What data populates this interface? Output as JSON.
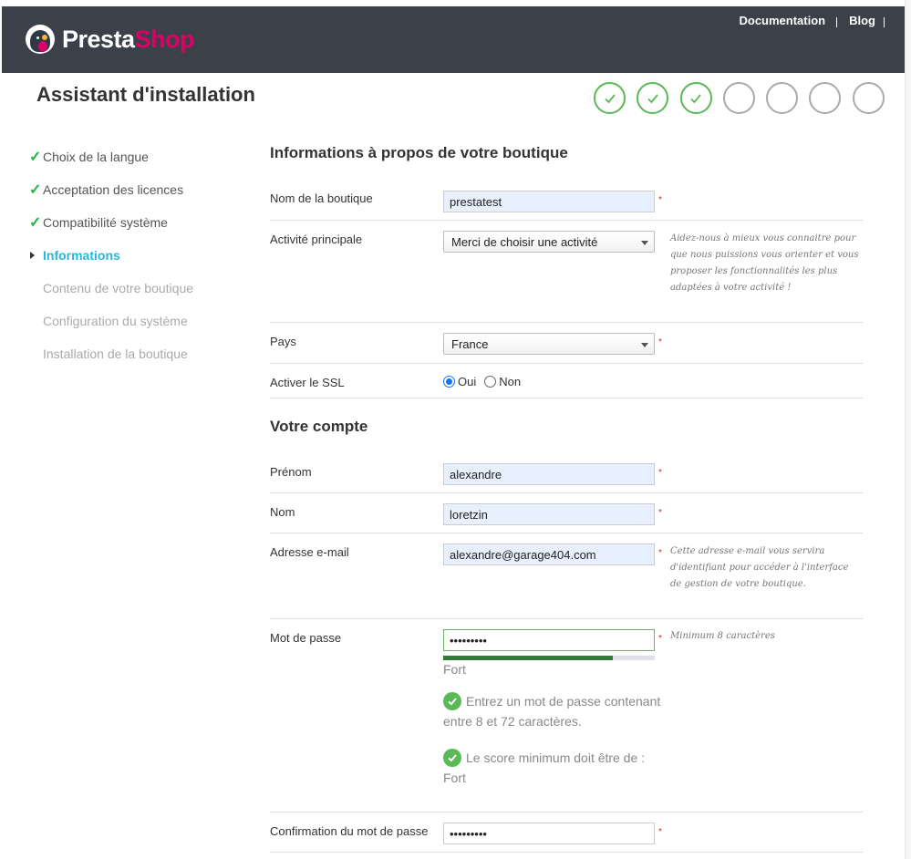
{
  "header": {
    "logo": {
      "part1": "Presta",
      "part2": "Shop"
    },
    "links": [
      "Documentation",
      "Blog"
    ]
  },
  "page_title": "Assistant d'installation",
  "progress": {
    "total_steps": 7,
    "completed_steps": 3
  },
  "sidebar": {
    "items": [
      {
        "label": "Choix de la langue",
        "state": "done"
      },
      {
        "label": "Acceptation des licences",
        "state": "done"
      },
      {
        "label": "Compatibilité système",
        "state": "done"
      },
      {
        "label": "Informations",
        "state": "active"
      },
      {
        "label": "Contenu de votre boutique",
        "state": "pending"
      },
      {
        "label": "Configuration du système",
        "state": "pending"
      },
      {
        "label": "Installation de la boutique",
        "state": "pending"
      }
    ]
  },
  "shop_section": {
    "title": "Informations à propos de votre boutique",
    "shop_name": {
      "label": "Nom de la boutique",
      "value": "prestatest",
      "required": "*"
    },
    "activity": {
      "label": "Activité principale",
      "value": "Merci de choisir une activité",
      "help": "Aidez-nous à mieux vous connaitre pour que nous puissions vous orienter et vous proposer les fonctionnalités les plus adaptées à votre activité !"
    },
    "country": {
      "label": "Pays",
      "value": "France",
      "required": "*"
    },
    "ssl": {
      "label": "Activer le SSL",
      "yes": "Oui",
      "no": "Non",
      "selected": "Oui"
    }
  },
  "account_section": {
    "title": "Votre compte",
    "firstname": {
      "label": "Prénom",
      "value": "alexandre",
      "required": "*"
    },
    "lastname": {
      "label": "Nom",
      "value": "loretzin",
      "required": "*"
    },
    "email": {
      "label": "Adresse e-mail",
      "value": "alexandre@garage404.com",
      "required": "*",
      "help": "Cette adresse e-mail vous servira d'identifiant pour accéder à l'interface de gestion de votre boutique."
    },
    "password": {
      "label": "Mot de passe",
      "value": "•••••••••",
      "required": "*",
      "help": "Minimum 8 caractères",
      "strength_label": "Fort",
      "strength_fraction": 0.8,
      "rules": [
        "Entrez un mot de passe contenant entre 8 et 72 caractères.",
        "Le score minimum doit être de : Fort"
      ]
    },
    "password_confirm": {
      "label": "Confirmation du mot de passe",
      "value": "•••••••••",
      "required": "*"
    }
  },
  "colors": {
    "accent": "#25b9d7",
    "success": "#5ab955",
    "brand_pink": "#df0067",
    "header_bg": "#3b4049"
  }
}
